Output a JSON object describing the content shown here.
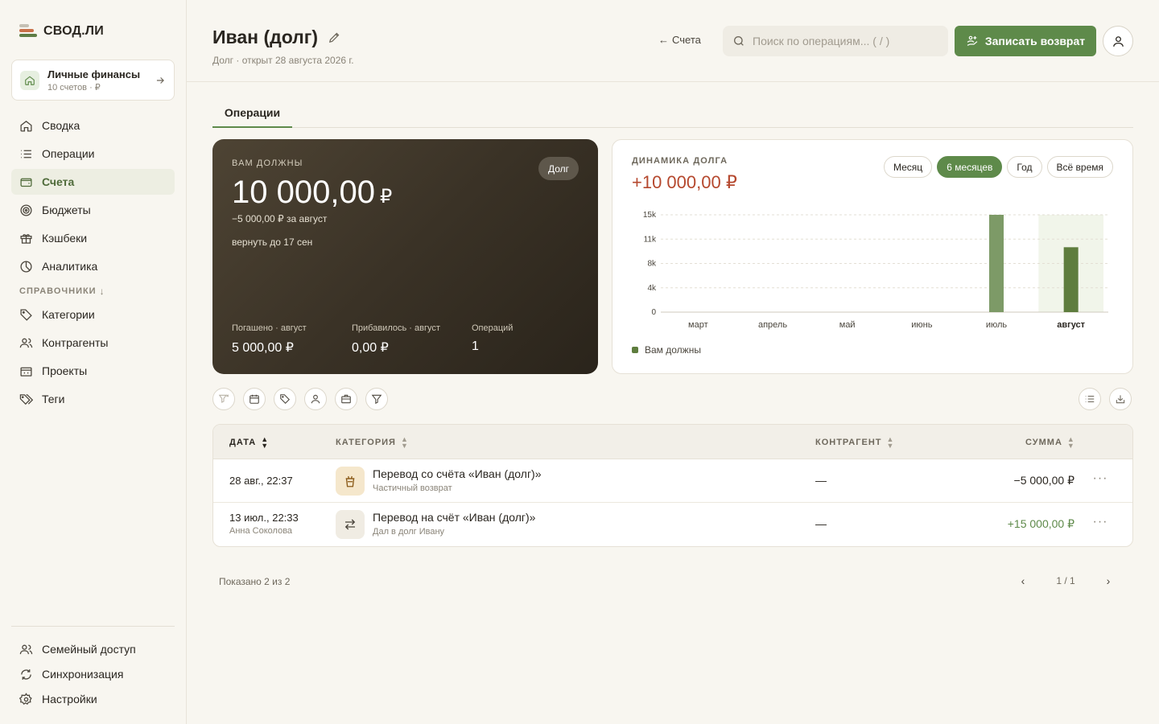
{
  "app": {
    "logo_text": "СВОД.ЛИ"
  },
  "workspace": {
    "title": "Личные финансы",
    "subtitle": "10 счетов · ₽"
  },
  "nav": {
    "items": [
      {
        "label": "Сводка",
        "icon": "home-icon"
      },
      {
        "label": "Операции",
        "icon": "list-icon"
      },
      {
        "label": "Счета",
        "icon": "wallet-icon",
        "active": true
      },
      {
        "label": "Бюджеты",
        "icon": "target-icon"
      },
      {
        "label": "Кэшбеки",
        "icon": "gift-icon"
      },
      {
        "label": "Аналитика",
        "icon": "chart-icon"
      }
    ],
    "section_label": "СПРАВОЧНИКИ",
    "ref_items": [
      {
        "label": "Категории",
        "icon": "tag-icon"
      },
      {
        "label": "Контрагенты",
        "icon": "users-icon"
      },
      {
        "label": "Проекты",
        "icon": "briefcase-icon"
      },
      {
        "label": "Теги",
        "icon": "tags-icon"
      }
    ],
    "bottom_items": [
      {
        "label": "Семейный доступ",
        "icon": "family-icon"
      },
      {
        "label": "Синхронизация",
        "icon": "sync-icon"
      },
      {
        "label": "Настройки",
        "icon": "gear-icon"
      }
    ]
  },
  "header": {
    "title": "Иван (долг)",
    "subtitle": "Долг · открыт 28 августа 2026 г.",
    "back_label": "Счета",
    "search_placeholder": "Поиск по операциям... ( / )",
    "primary_button": "Записать возврат"
  },
  "tabs": [
    {
      "label": "Операции",
      "active": true
    }
  ],
  "balance_card": {
    "label": "ВАМ ДОЛЖНЫ",
    "amount": "10 000,00",
    "currency": "₽",
    "delta": "−5 000,00 ₽ за август",
    "due": "вернуть до 17 сен",
    "badge": "Долг",
    "stats": [
      {
        "label": "Погашено · август",
        "value": "5 000,00 ₽"
      },
      {
        "label": "Прибавилось · август",
        "value": "0,00 ₽"
      },
      {
        "label": "Операций",
        "value": "1"
      }
    ]
  },
  "chart_card": {
    "label": "ДИНАМИКА ДОЛГА",
    "value": "+10 000,00 ₽",
    "periods": [
      {
        "label": "Месяц",
        "active": false
      },
      {
        "label": "6 месяцев",
        "active": true
      },
      {
        "label": "Год",
        "active": false
      },
      {
        "label": "Всё время",
        "active": false
      }
    ],
    "legend": "Вам должны"
  },
  "chart_data": {
    "type": "bar",
    "categories": [
      "март",
      "апрель",
      "май",
      "июнь",
      "июль",
      "август"
    ],
    "values": [
      0,
      0,
      0,
      0,
      15000,
      10000
    ],
    "highlight_category": "август",
    "yticks": [
      "15k",
      "11k",
      "8k",
      "4k",
      "0"
    ],
    "ylim": [
      0,
      15000
    ],
    "grid": true,
    "legend_position": "bottom-left",
    "colors": {
      "bar": "#7d9a67",
      "bar_highlight": "#5e7d3e",
      "highlight_bg": "#f1f5ea"
    }
  },
  "filters": [
    {
      "name": "reset-filter-icon"
    },
    {
      "name": "calendar-icon"
    },
    {
      "name": "tag-icon"
    },
    {
      "name": "person-icon"
    },
    {
      "name": "briefcase-icon"
    },
    {
      "name": "filter-icon"
    }
  ],
  "table": {
    "columns": [
      "ДАТА",
      "КАТЕГОРИЯ",
      "КОНТРАГЕНТ",
      "СУММА"
    ],
    "rows": [
      {
        "date": "28 авг., 22:37",
        "date_sub": "",
        "icon": "cup-icon",
        "title": "Перевод со счёта «Иван (долг)»",
        "subtitle": "Частичный возврат",
        "counterparty": "—",
        "amount": "−5 000,00 ₽",
        "amount_color": "#2a2620"
      },
      {
        "date": "13 июл., 22:33",
        "date_sub": "Анна Соколова",
        "icon": "transfer-icon",
        "title": "Перевод на счёт «Иван (долг)»",
        "subtitle": "Дал в долг Ивану",
        "counterparty": "—",
        "amount": "+15 000,00 ₽",
        "amount_color": "#5e8a4a"
      }
    ]
  },
  "footer": {
    "count": "Показано 2 из 2",
    "page": "1 / 1",
    "prev": "‹",
    "next": "›"
  },
  "colors": {
    "accent": "#5e8a4a",
    "negative": "#b5482e"
  }
}
